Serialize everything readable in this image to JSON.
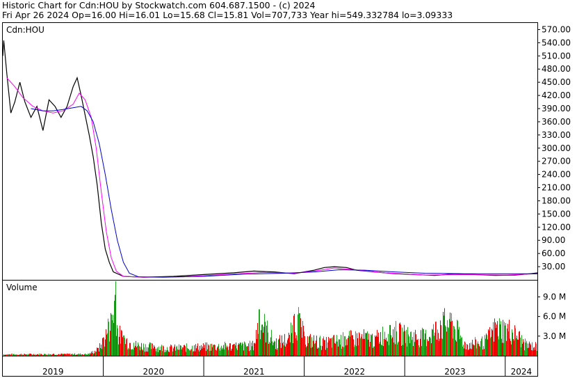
{
  "header": {
    "line1": "Historic Chart for Cdn:HOU by Stockwatch.com 604.687.1500 - (c) 2024",
    "line2": "Fri Apr 26 2024   Op=16.00   Hi=16.01   Lo=15.68   Cl=15.81   Vol=707,733   Year hi=549.332784   lo=3.09333"
  },
  "colors": {
    "price_bar": "#000000",
    "ma_short": "#ff00ff",
    "ma_long": "#0000cc",
    "volume_up": "#22aa22",
    "volume_down": "#ee0000",
    "axis": "#000000"
  },
  "chart_data": [
    {
      "type": "line",
      "title": "Cdn:HOU",
      "x": [
        "2019",
        "2020",
        "2021",
        "2022",
        "2023",
        "2024"
      ],
      "ylim": [
        0,
        585
      ],
      "yticks": [
        "570.00",
        "540.00",
        "510.00",
        "480.00",
        "450.00",
        "420.00",
        "390.00",
        "360.00",
        "330.00",
        "300.00",
        "270.00",
        "240.00",
        "210.00",
        "180.00",
        "150.00",
        "120.00",
        "90.00",
        "60.00",
        "30.00"
      ],
      "series": [
        {
          "values": [
            [
              2019.0,
              510
            ],
            [
              2019.01,
              545
            ],
            [
              2019.04,
              470
            ],
            [
              2019.08,
              380
            ],
            [
              2019.12,
              405
            ],
            [
              2019.17,
              450
            ],
            [
              2019.22,
              405
            ],
            [
              2019.28,
              370
            ],
            [
              2019.34,
              395
            ],
            [
              2019.4,
              340
            ],
            [
              2019.46,
              410
            ],
            [
              2019.52,
              395
            ],
            [
              2019.58,
              370
            ],
            [
              2019.64,
              395
            ],
            [
              2019.7,
              440
            ],
            [
              2019.74,
              460
            ],
            [
              2019.78,
              420
            ],
            [
              2019.82,
              375
            ],
            [
              2019.86,
              330
            ],
            [
              2019.9,
              280
            ],
            [
              2019.94,
              215
            ],
            [
              2019.98,
              130
            ],
            [
              2020.02,
              70
            ],
            [
              2020.06,
              40
            ],
            [
              2020.1,
              18
            ],
            [
              2020.2,
              8
            ],
            [
              2020.4,
              6
            ],
            [
              2020.7,
              8
            ],
            [
              2021.0,
              12
            ],
            [
              2021.3,
              16
            ],
            [
              2021.5,
              20
            ],
            [
              2021.7,
              18
            ],
            [
              2021.9,
              14
            ],
            [
              2022.0,
              18
            ],
            [
              2022.1,
              22
            ],
            [
              2022.2,
              28
            ],
            [
              2022.3,
              30
            ],
            [
              2022.42,
              28
            ],
            [
              2022.52,
              22
            ],
            [
              2022.7,
              18
            ],
            [
              2022.9,
              14
            ],
            [
              2023.1,
              12
            ],
            [
              2023.3,
              10
            ],
            [
              2023.5,
              14
            ],
            [
              2023.7,
              12
            ],
            [
              2023.9,
              10
            ],
            [
              2024.1,
              11
            ],
            [
              2024.25,
              14
            ],
            [
              2024.32,
              15.81
            ]
          ]
        },
        {
          "values": [
            [
              2019.04,
              460
            ],
            [
              2019.12,
              440
            ],
            [
              2019.2,
              415
            ],
            [
              2019.3,
              395
            ],
            [
              2019.4,
              385
            ],
            [
              2019.5,
              380
            ],
            [
              2019.6,
              385
            ],
            [
              2019.7,
              400
            ],
            [
              2019.76,
              425
            ],
            [
              2019.82,
              410
            ],
            [
              2019.88,
              370
            ],
            [
              2019.93,
              300
            ],
            [
              2019.98,
              200
            ],
            [
              2020.03,
              110
            ],
            [
              2020.08,
              50
            ],
            [
              2020.13,
              20
            ],
            [
              2020.2,
              8
            ],
            [
              2020.4,
              6
            ],
            [
              2020.8,
              7
            ],
            [
              2021.2,
              12
            ],
            [
              2021.6,
              17
            ],
            [
              2021.9,
              15
            ],
            [
              2022.1,
              20
            ],
            [
              2022.3,
              27
            ],
            [
              2022.5,
              23
            ],
            [
              2022.8,
              16
            ],
            [
              2023.2,
              11
            ],
            [
              2023.6,
              12
            ],
            [
              2024.0,
              11
            ],
            [
              2024.32,
              14
            ]
          ]
        },
        {
          "values": [
            [
              2019.28,
              390
            ],
            [
              2019.4,
              385
            ],
            [
              2019.5,
              385
            ],
            [
              2019.6,
              388
            ],
            [
              2019.7,
              392
            ],
            [
              2019.78,
              395
            ],
            [
              2019.84,
              385
            ],
            [
              2019.9,
              360
            ],
            [
              2019.96,
              310
            ],
            [
              2020.02,
              240
            ],
            [
              2020.08,
              160
            ],
            [
              2020.14,
              90
            ],
            [
              2020.2,
              40
            ],
            [
              2020.26,
              15
            ],
            [
              2020.35,
              7
            ],
            [
              2020.6,
              6
            ],
            [
              2021.0,
              8
            ],
            [
              2021.4,
              13
            ],
            [
              2021.8,
              15
            ],
            [
              2022.1,
              18
            ],
            [
              2022.35,
              23
            ],
            [
              2022.6,
              22
            ],
            [
              2022.9,
              18
            ],
            [
              2023.2,
              15
            ],
            [
              2023.6,
              14
            ],
            [
              2024.0,
              14
            ],
            [
              2024.32,
              14
            ]
          ]
        }
      ]
    },
    {
      "type": "bar",
      "title": "Volume",
      "ylim": [
        0,
        11.5
      ],
      "yticks": [
        "9.0 M",
        "6.0 M",
        "3.0 M"
      ],
      "series": [
        {
          "values": [
            [
              2019.0,
              0.25
            ],
            [
              2019.5,
              0.3
            ],
            [
              2019.85,
              0.3
            ],
            [
              2019.95,
              1.2
            ],
            [
              2020.0,
              2.8
            ],
            [
              2020.05,
              5.2
            ],
            [
              2020.08,
              6.3
            ],
            [
              2020.12,
              11.4
            ],
            [
              2020.14,
              4.2
            ],
            [
              2020.2,
              3.1
            ],
            [
              2020.3,
              2.0
            ],
            [
              2020.5,
              1.6
            ],
            [
              2020.7,
              1.4
            ],
            [
              2020.9,
              1.6
            ],
            [
              2021.1,
              1.7
            ],
            [
              2021.3,
              1.8
            ],
            [
              2021.5,
              1.9
            ],
            [
              2021.55,
              7.1
            ],
            [
              2021.7,
              2.3
            ],
            [
              2021.85,
              3.2
            ],
            [
              2021.9,
              6.4
            ],
            [
              2021.95,
              6.5
            ],
            [
              2022.0,
              3.0
            ],
            [
              2022.2,
              2.4
            ],
            [
              2022.4,
              3.0
            ],
            [
              2022.55,
              3.4
            ],
            [
              2022.7,
              3.1
            ],
            [
              2022.85,
              4.7
            ],
            [
              2023.0,
              3.8
            ],
            [
              2023.2,
              3.4
            ],
            [
              2023.35,
              5.4
            ],
            [
              2023.45,
              6.6
            ],
            [
              2023.6,
              2.0
            ],
            [
              2023.8,
              2.6
            ],
            [
              2023.9,
              5.1
            ],
            [
              2024.0,
              5.0
            ],
            [
              2024.1,
              4.2
            ],
            [
              2024.2,
              2.0
            ],
            [
              2024.32,
              1.7
            ]
          ]
        }
      ]
    }
  ]
}
